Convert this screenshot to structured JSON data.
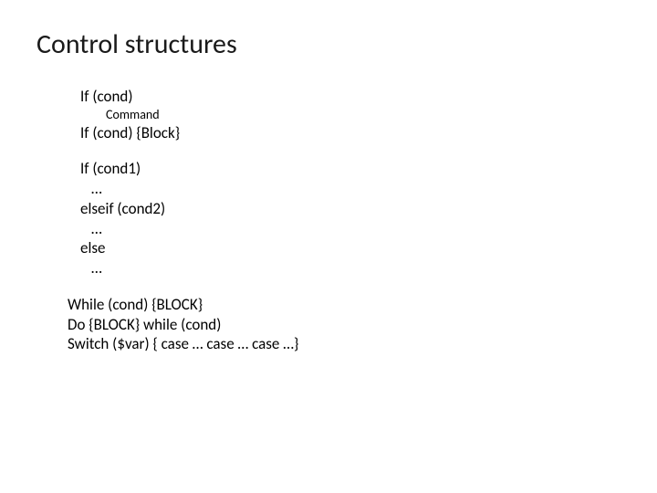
{
  "title": "Control structures",
  "lines": {
    "if_cond": "If (cond)",
    "command": "Command",
    "if_cond_block": "If (cond) {Block}",
    "if_cond1": "If (cond1)",
    "dots1": "…",
    "elseif_cond2": "elseif (cond2)",
    "dots2": "…",
    "else_kw": "else",
    "dots3": "…",
    "while_line": "While (cond) {BLOCK}",
    "do_line": "Do {BLOCK} while (cond)",
    "switch_line": "Switch ($var) { case … case … case …}"
  }
}
